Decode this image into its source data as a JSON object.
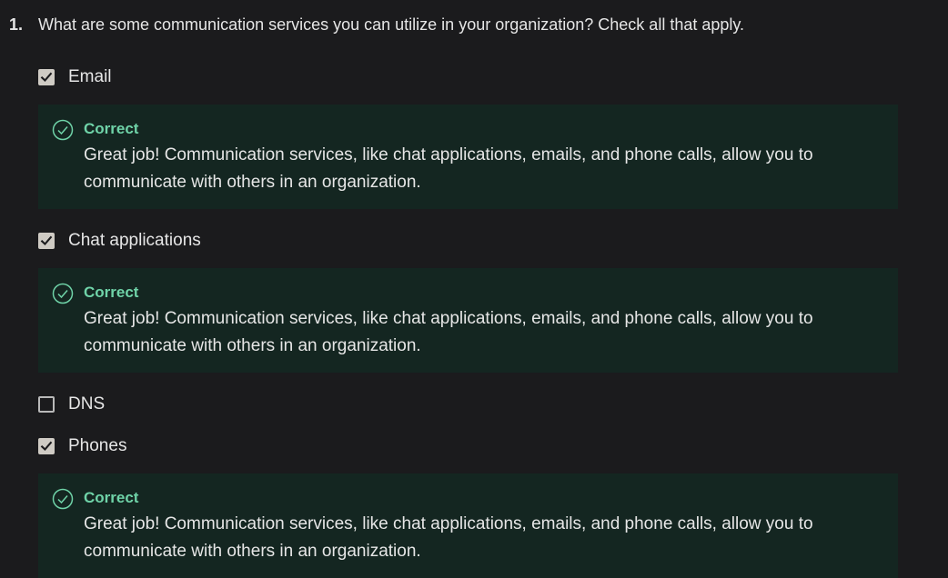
{
  "question": {
    "number": "1.",
    "text": "What are some communication services you can utilize in your organization? Check all that apply."
  },
  "options": [
    {
      "label": "Email",
      "checked": true
    },
    {
      "label": "Chat applications",
      "checked": true
    },
    {
      "label": "DNS",
      "checked": false
    },
    {
      "label": "Phones",
      "checked": true
    }
  ],
  "feedback": [
    {
      "title": "Correct",
      "text": "Great job! Communication services, like chat applications, emails, and phone calls, allow you to communicate with others in an organization."
    },
    {
      "title": "Correct",
      "text": "Great job! Communication services, like chat applications, emails, and phone calls, allow you to communicate with others in an organization."
    },
    {
      "title": "Correct",
      "text": "Great job! Communication services, like chat applications, emails, and phone calls, allow you to communicate with others in an organization."
    }
  ],
  "colors": {
    "background": "#1b1b1d",
    "feedback_bg": "#142621",
    "correct_green": "#6fd3a8",
    "checkbox_checked": "#cfcbc4"
  }
}
